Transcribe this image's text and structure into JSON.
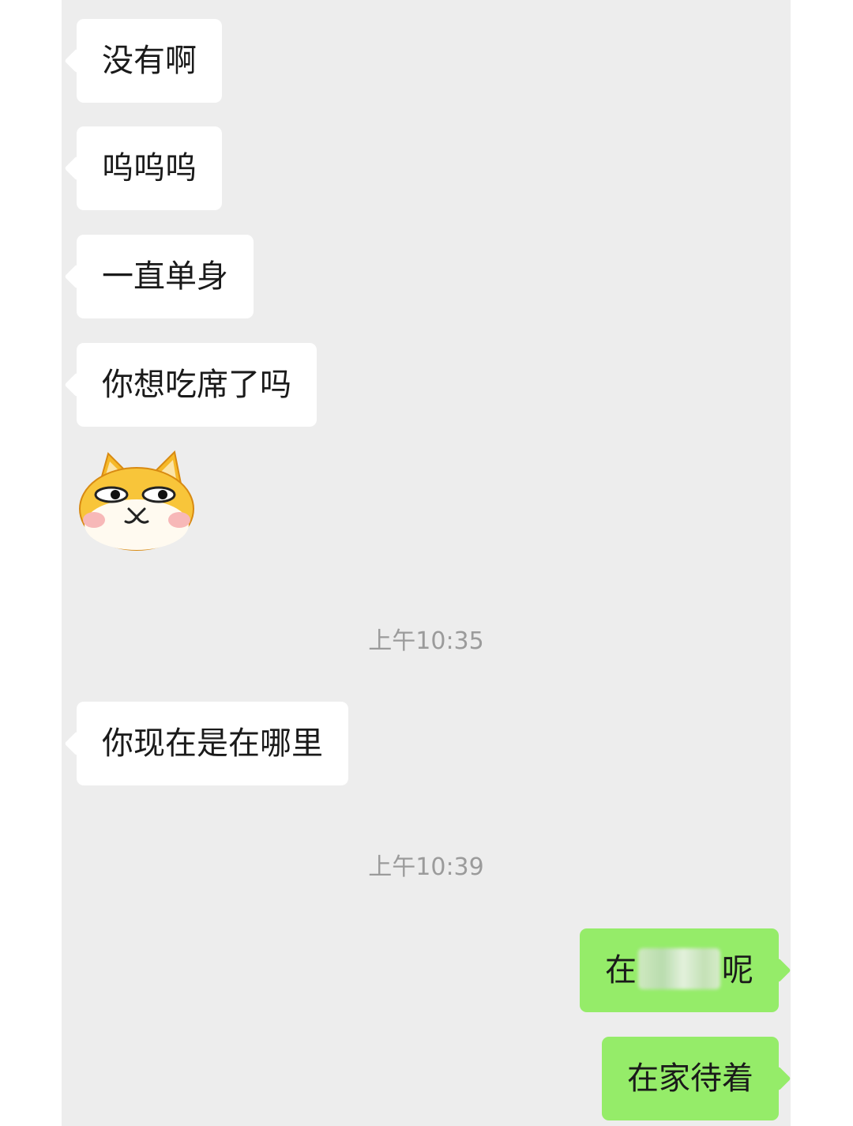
{
  "messages": [
    {
      "side": "incoming",
      "type": "text",
      "text": "没有啊"
    },
    {
      "side": "incoming",
      "type": "text",
      "text": "呜呜呜"
    },
    {
      "side": "incoming",
      "type": "text",
      "text": "一直单身"
    },
    {
      "side": "incoming",
      "type": "text",
      "text": "你想吃席了吗"
    },
    {
      "side": "incoming",
      "type": "sticker",
      "sticker": "shiba-dog-side-eye-sticker"
    },
    {
      "type": "timestamp",
      "text": "上午10:35"
    },
    {
      "side": "incoming",
      "type": "text",
      "text": "你现在是在哪里"
    },
    {
      "type": "timestamp",
      "text": "上午10:39"
    },
    {
      "side": "outgoing",
      "type": "text",
      "text_before": "在",
      "text_after": "呢",
      "redacted": true
    },
    {
      "side": "outgoing",
      "type": "text",
      "text": "在家待着"
    }
  ],
  "colors": {
    "chat_background": "#ededed",
    "incoming_bubble": "#ffffff",
    "outgoing_bubble": "#95ec69",
    "timestamp_text": "#9b9b9b"
  }
}
